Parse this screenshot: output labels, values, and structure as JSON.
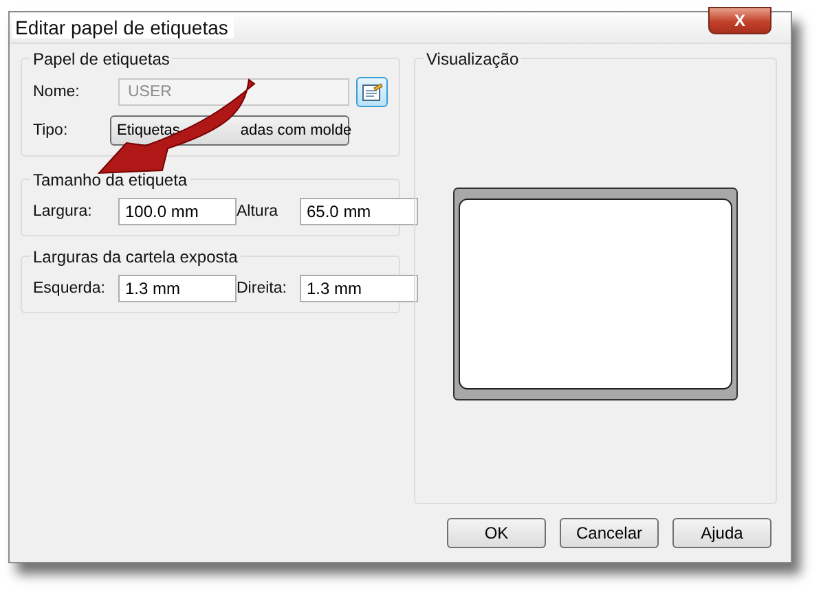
{
  "window": {
    "title": "Editar papel de etiquetas",
    "close": "X"
  },
  "paper_group": {
    "title": "Papel de etiquetas",
    "name_label": "Nome:",
    "name_value": "USER",
    "name_disabled": true,
    "type_label": "Tipo:",
    "type_value_parts": [
      "Etiquetas",
      "adas com molde"
    ]
  },
  "size_group": {
    "title": "Tamanho da etiqueta",
    "fields": [
      {
        "label": "Largura:",
        "value": "100.0 mm"
      },
      {
        "label": "Altura",
        "value": "65.0 mm"
      }
    ]
  },
  "liner_group": {
    "title": "Larguras da cartela exposta",
    "fields": [
      {
        "label": "Esquerda:",
        "value": "1.3 mm"
      },
      {
        "label": "Direita:",
        "value": "1.3 mm"
      }
    ]
  },
  "preview": {
    "title": "Visualização"
  },
  "buttons": [
    "OK",
    "Cancelar",
    "Ajuda"
  ]
}
